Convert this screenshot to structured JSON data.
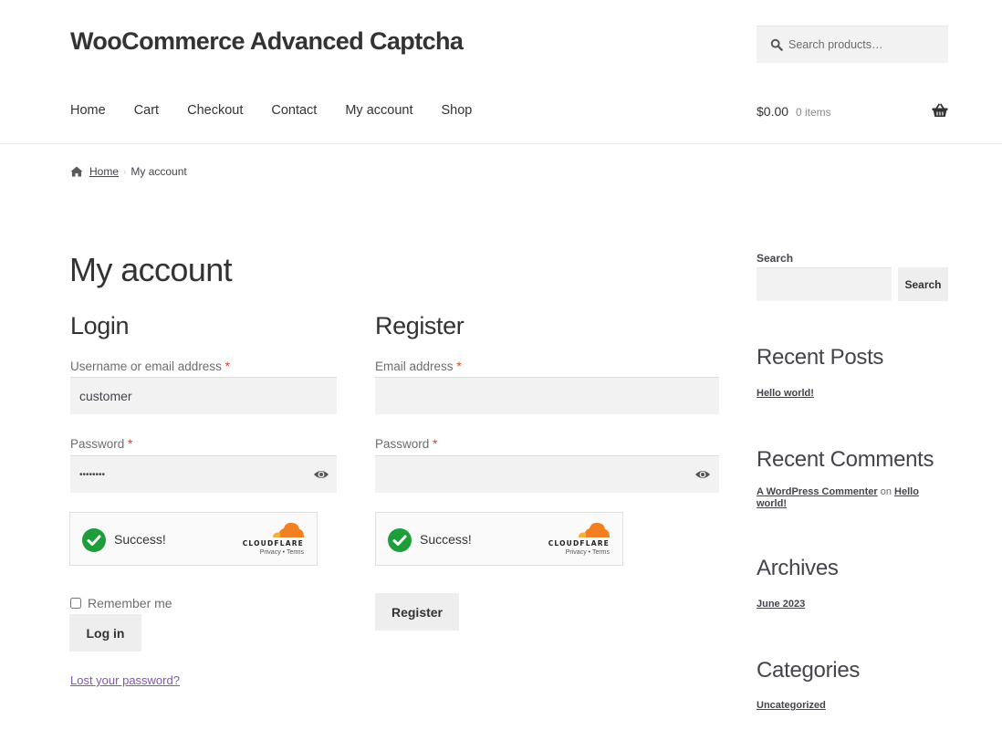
{
  "site": {
    "title": "WooCommerce Advanced Captcha"
  },
  "header": {
    "search_placeholder": "Search products…",
    "nav": [
      "Home",
      "Cart",
      "Checkout",
      "Contact",
      "My account",
      "Shop"
    ],
    "cart_total": "$0.00",
    "cart_count": "0 items"
  },
  "breadcrumb": {
    "home": "Home",
    "separator": "›",
    "current": "My account"
  },
  "page": {
    "title": "My account"
  },
  "login": {
    "heading": "Login",
    "username_label": "Username or email address",
    "username_value": "customer",
    "password_label": "Password",
    "password_value": "••••••••",
    "required_mark": "*",
    "captcha_status": "Success!",
    "captcha_brand": "CLOUDFLARE",
    "captcha_privacy": "Privacy",
    "captcha_dot": "•",
    "captcha_terms": "Terms",
    "remember_label": "Remember me",
    "remember_checked": false,
    "submit_label": "Log in",
    "lost_password": "Lost your password?"
  },
  "register": {
    "heading": "Register",
    "email_label": "Email address",
    "email_value": "",
    "password_label": "Password",
    "password_value": "",
    "required_mark": "*",
    "captcha_status": "Success!",
    "captcha_brand": "CLOUDFLARE",
    "captcha_privacy": "Privacy",
    "captcha_dot": "•",
    "captcha_terms": "Terms",
    "submit_label": "Register"
  },
  "sidebar": {
    "search_label": "Search",
    "search_button": "Search",
    "recent_posts_title": "Recent Posts",
    "recent_posts": [
      "Hello world!"
    ],
    "recent_comments_title": "Recent Comments",
    "recent_comment": {
      "author": "A WordPress Commenter",
      "connector": "on",
      "post": "Hello world!"
    },
    "archives_title": "Archives",
    "archives": [
      "June 2023"
    ],
    "categories_title": "Categories",
    "categories": [
      "Uncategorized"
    ]
  },
  "colors": {
    "required": "#e2401c",
    "link_visited": "#7f54b3",
    "captcha_success": "#1e9e3a",
    "cloudflare_orange": "#f38020"
  }
}
